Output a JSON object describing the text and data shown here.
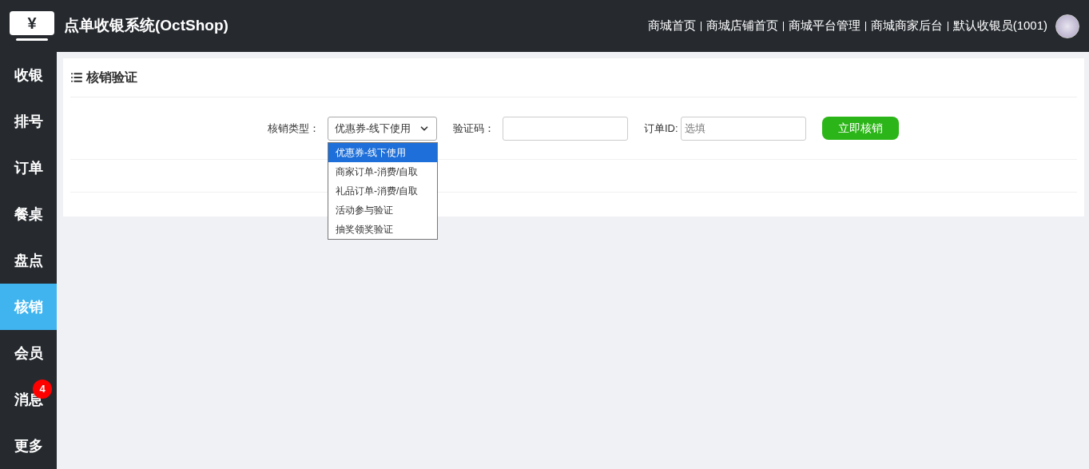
{
  "header": {
    "logo_glyph": "¥",
    "title": "点单收银系统(OctShop)",
    "links": [
      "商城首页",
      "商城店铺首页",
      "商城平台管理",
      "商城商家后台"
    ],
    "user": "默认收银员(1001)"
  },
  "sidebar": {
    "items": [
      {
        "label": "收银",
        "selected": false
      },
      {
        "label": "排号",
        "selected": false
      },
      {
        "label": "订单",
        "selected": false
      },
      {
        "label": "餐桌",
        "selected": false
      },
      {
        "label": "盘点",
        "selected": false
      },
      {
        "label": "核销",
        "selected": true
      },
      {
        "label": "会员",
        "selected": false
      },
      {
        "label": "消息",
        "selected": false,
        "badge": "4"
      },
      {
        "label": "更多",
        "selected": false
      }
    ]
  },
  "card": {
    "title": "核销验证",
    "form": {
      "type_label": "核销类型：",
      "type_value": "优惠券-线下使用",
      "code_label": "验证码：",
      "order_label": "订单ID:",
      "order_placeholder": "选填",
      "submit": "立即核销"
    },
    "dropdown": {
      "expanded": true,
      "options": [
        {
          "label": "优惠券-线下使用",
          "selected": true
        },
        {
          "label": "商家订单-消费/自取",
          "selected": false
        },
        {
          "label": "礼品订单-消费/自取",
          "selected": false
        },
        {
          "label": "活动参与验证",
          "selected": false
        },
        {
          "label": "抽奖领奖验证",
          "selected": false
        }
      ]
    }
  }
}
